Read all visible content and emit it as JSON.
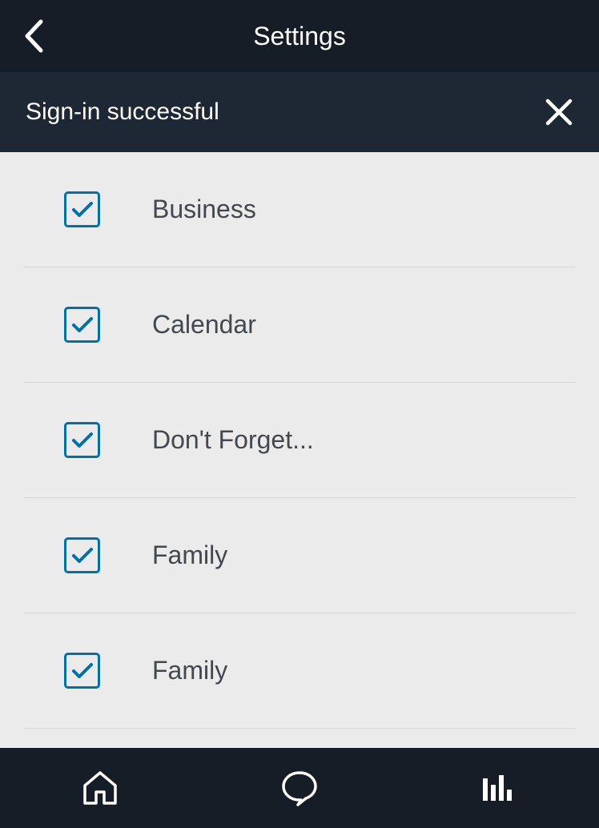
{
  "header": {
    "title": "Settings"
  },
  "notification": {
    "text": "Sign-in successful"
  },
  "items": [
    {
      "label": "Business",
      "checked": true
    },
    {
      "label": "Calendar",
      "checked": true
    },
    {
      "label": "Don't Forget...",
      "checked": true
    },
    {
      "label": "Family",
      "checked": true
    },
    {
      "label": "Family",
      "checked": true
    }
  ]
}
